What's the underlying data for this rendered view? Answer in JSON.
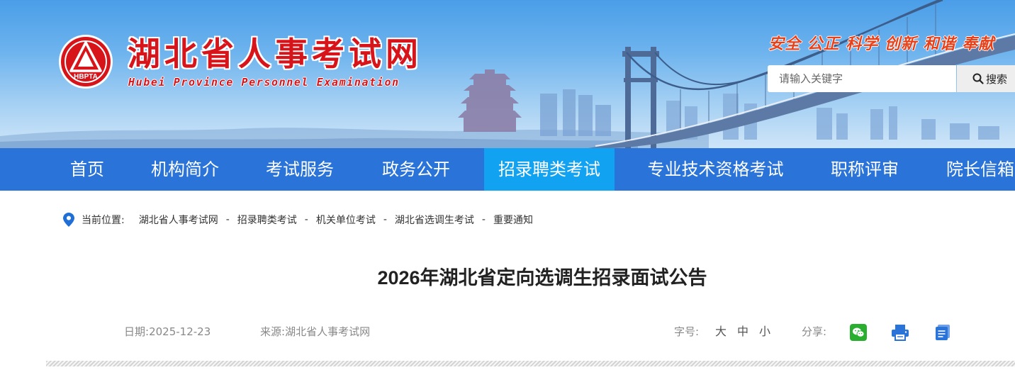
{
  "header": {
    "site_title": "湖北省人事考试网",
    "site_subtitle": "Hubei Province Personnel Examination",
    "logo_text": "HBPTA",
    "motto": "安全 公正 科学 创新 和谐 奉献",
    "search": {
      "placeholder": "请输入关键字",
      "button_label": "搜索"
    }
  },
  "nav": {
    "items": [
      {
        "label": "首页"
      },
      {
        "label": "机构简介"
      },
      {
        "label": "考试服务"
      },
      {
        "label": "政务公开"
      },
      {
        "label": "招录聘类考试",
        "active": true
      },
      {
        "label": "专业技术资格考试"
      },
      {
        "label": "职称评审"
      },
      {
        "label": "院长信箱"
      }
    ]
  },
  "breadcrumb": {
    "label": "当前位置:",
    "separator": "-",
    "items": [
      "湖北省人事考试网",
      "招录聘类考试",
      "机关单位考试",
      "湖北省选调生考试",
      "重要通知"
    ]
  },
  "article": {
    "title": "2026年湖北省定向选调生招录面试公告",
    "date_label": "日期:",
    "date": "2025-12-23",
    "source_label": "来源:",
    "source": "湖北省人事考试网",
    "font_size_label": "字号:",
    "font_sizes": [
      "大",
      "中",
      "小"
    ],
    "share_label": "分享:"
  },
  "icons": {
    "search": "search-icon",
    "location": "location-pin-icon",
    "wechat": "wechat-icon",
    "print": "printer-icon",
    "copy": "document-icon"
  },
  "colors": {
    "nav_bg": "#2a73d9",
    "nav_active": "#11a2f2",
    "brand_red": "#d8141b",
    "motto": "#e8411a",
    "wechat_green": "#2aae30",
    "icon_blue": "#2a73d9"
  }
}
